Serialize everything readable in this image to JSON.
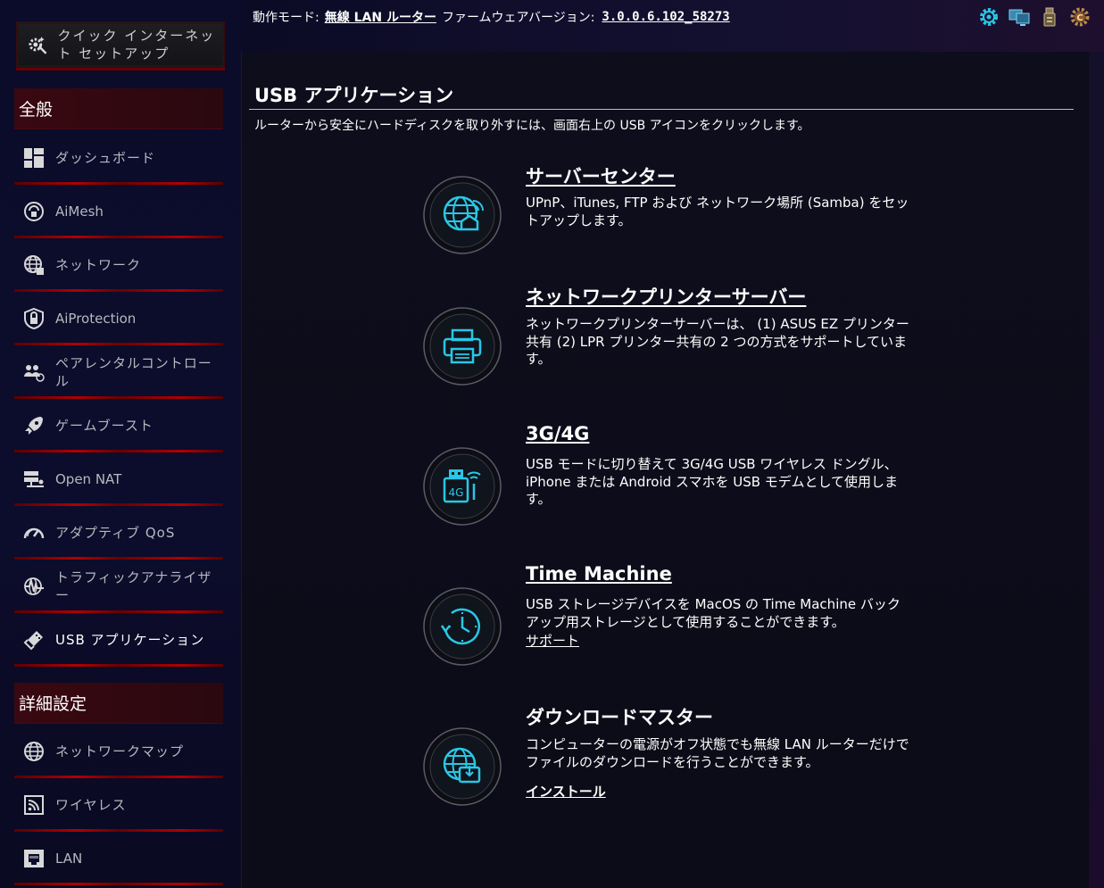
{
  "topbar": {
    "mode_label": "動作モード:",
    "mode_value": "無線 LAN ルーター",
    "firmware_label": "ファームウェアバージョン:",
    "firmware_value": "3.0.0.6.102_58273"
  },
  "top_icons": [
    "gear-icon",
    "network-monitor-icon",
    "usb-icon",
    "update-icon"
  ],
  "sidebar": {
    "quick_setup": "クイック インターネット セットアップ",
    "general_header": "全般",
    "general_items": [
      {
        "label": "ダッシュボード",
        "icon": "dashboard-icon"
      },
      {
        "label": "AiMesh",
        "icon": "aimesh-icon"
      },
      {
        "label": "ネットワーク",
        "icon": "network-globe-icon"
      },
      {
        "label": "AiProtection",
        "icon": "shield-icon"
      },
      {
        "label": "ペアレンタルコントロール",
        "icon": "parental-icon"
      },
      {
        "label": "ゲームブースト",
        "icon": "rocket-icon"
      },
      {
        "label": "Open NAT",
        "icon": "open-nat-icon"
      },
      {
        "label": "アダプティブ QoS",
        "icon": "gauge-icon"
      },
      {
        "label": "トラフィックアナライザー",
        "icon": "traffic-icon"
      },
      {
        "label": "USB アプリケーション",
        "icon": "usb-app-icon",
        "active": true
      }
    ],
    "advanced_header": "詳細設定",
    "advanced_items": [
      {
        "label": "ネットワークマップ",
        "icon": "network-map-icon"
      },
      {
        "label": "ワイヤレス",
        "icon": "wireless-icon"
      },
      {
        "label": "LAN",
        "icon": "lan-icon"
      }
    ]
  },
  "main": {
    "title": "USB アプリケーション",
    "description": "ルーターから安全にハードディスクを取り外すには、画面右上の USB アイコンをクリックします。",
    "apps": [
      {
        "title": "サーバーセンター",
        "desc": "UPnP、iTunes, FTP および ネットワーク場所 (Samba) をセットアップします。",
        "icon": "server-center-icon"
      },
      {
        "title": "ネットワークプリンターサーバー",
        "desc": "ネットワークプリンターサーバーは、 (1) ASUS EZ プリンター共有 (2) LPR プリンター共有の 2 つの方式をサポートしています。",
        "icon": "printer-icon"
      },
      {
        "title": "3G/4G",
        "desc": "USB モードに切り替えて 3G/4G USB ワイヤレス ドングル、iPhone または Android スマホを USB モデムとして使用します。",
        "icon": "usb-modem-4g-icon"
      },
      {
        "title": "Time Machine",
        "desc": "USB ストレージデバイスを MacOS の Time Machine バックアップ用ストレージとして使用することができます。",
        "link": "サポート",
        "icon": "time-machine-icon"
      },
      {
        "title": "ダウンロードマスター",
        "desc": "コンピューターの電源がオフ状態でも無線 LAN ルーターだけでファイルのダウンロードを行うことができます。",
        "link": "インストール",
        "icon": "download-master-icon"
      }
    ]
  },
  "colors": {
    "accent_cyan": "#29c7e6",
    "nav_red": "#b00000",
    "section_bg": "#3a0810"
  }
}
